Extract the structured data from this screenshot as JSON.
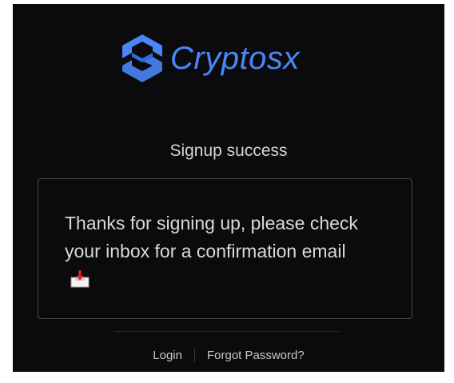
{
  "brand": {
    "name": "Cryptosx",
    "accent_color": "#4a86f7",
    "logo_icon": "cryptosx-logo-icon"
  },
  "page": {
    "title": "Signup success"
  },
  "card": {
    "message": "Thanks for signing up, please check your inbox for a confirmation email",
    "icon": "inbox-tray-icon"
  },
  "footer": {
    "login_label": "Login",
    "forgot_label": "Forgot Password?"
  }
}
